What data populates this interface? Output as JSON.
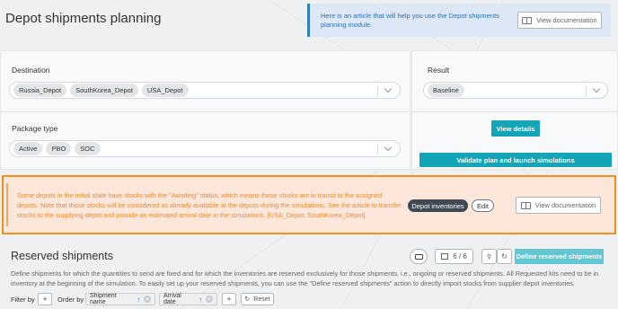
{
  "header": {
    "title": "Depot shipments planning",
    "info_text": "Here is an article that will help you use the Depot shipments planning module.",
    "view_doc_label": "View documentation"
  },
  "destination": {
    "label": "Destination",
    "chips": [
      "Russia_Depot",
      "SouthKorea_Depot",
      "USA_Depot"
    ]
  },
  "package_type": {
    "label": "Package type",
    "chips": [
      "Active",
      "PBO",
      "SOC"
    ]
  },
  "result": {
    "label": "Result",
    "selected": "Baseline",
    "view_details_label": "View details",
    "validate_label": "Validate plan and launch simulations"
  },
  "warning": {
    "text": "Some depots in the initial state have stocks with the \"Awaiting\" status, which means those stocks are in transit to the assigned depots. Note that those stocks will be considered as already available at the depots during the simulations. See the article to transfer stocks to the supplying depot and provide an estimated arrival date in the simulations. [USA_Depot, SouthKorea_Depot]",
    "depot_inventories_label": "Depot inventories",
    "edit_label": "Edit",
    "view_doc_label": "View documentation"
  },
  "reserved": {
    "title": "Reserved shipments",
    "column_count": "6 / 6",
    "define_label": "Define reserved shipments",
    "description": "Define shipments for which the quantities to send are fixed and for which the inventories are reserved exclusively for those shipments, i.e., ongoing or reserved shipments. All Requested kits need to be in inventory at the beginning of the simulation. To easily set up your reserved shipments, you can use the \"Define reserved shipments\" action to directly import stocks from supplier depot inventories.",
    "filter_label": "Filter by",
    "order_label": "Order by",
    "sort_fields": [
      "Shipment name",
      "Arrival date"
    ],
    "reset_label": "Reset"
  },
  "colors": {
    "accent": "#13a5b7",
    "warning_border": "#f2911b",
    "warning_text": "#ec8a2d",
    "info_bg": "#dce8f5"
  }
}
